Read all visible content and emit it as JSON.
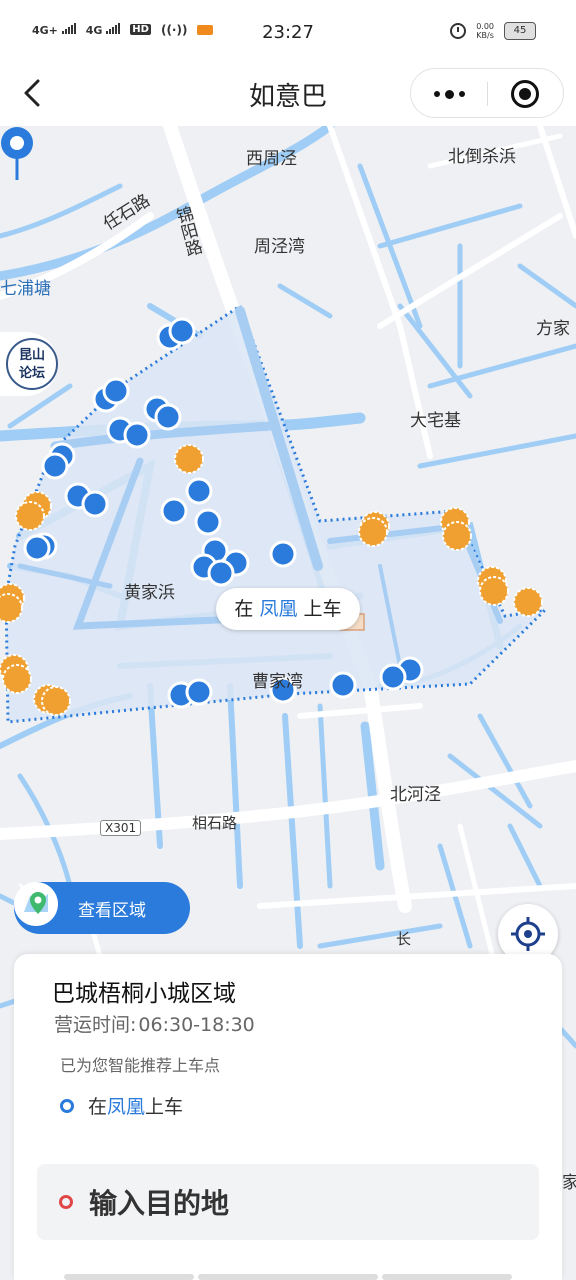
{
  "status_bar": {
    "network_1": "4G+",
    "network_2": "4G",
    "hd": "HD",
    "time": "23:27",
    "speed_value": "0.00",
    "speed_unit": "KB/s",
    "battery": "45"
  },
  "nav": {
    "title": "如意巴",
    "back_icon": "chevron-left-icon",
    "more_icon": "more-dots-icon",
    "close_icon": "target-close-icon"
  },
  "map": {
    "places": {
      "xizhoujing": "西周泾",
      "beidaoshabang": "北倒杀浜",
      "renshilu": "任石路",
      "jinyanglu": "锦阳路",
      "zhoujingwan": "周泾湾",
      "qiputang": "七浦塘",
      "fangjia": "方家",
      "dazhaiji": "大宅基",
      "huangjiabang": "黄家浜",
      "caojiawan": "曹家湾",
      "beihejing": "北河泾",
      "xiangshilu": "相石路",
      "x301": "X301",
      "chang": "长",
      "jia": "家"
    },
    "forum_logo": "昆山论坛",
    "pickup_bubble": {
      "prefix": "在",
      "station": "凤凰",
      "suffix": "上车"
    },
    "view_area_button": "查看区域",
    "locate_icon": "crosshair-locate-icon",
    "colors": {
      "zone_fill": "#dbe5f5",
      "zone_border": "#2a7bdc",
      "stop_blue": "#2a7bdc",
      "stop_orange": "#f0a030",
      "water": "#9fcdf5"
    }
  },
  "card": {
    "zone_name": "巴城梧桐小城区域",
    "hours_label": "营运时间:",
    "hours_value": "06:30-18:30",
    "recommend_text": "已为您智能推荐上车点",
    "pickup_prefix": "在",
    "pickup_station": "凤凰",
    "pickup_suffix": "上车",
    "destination_placeholder": "输入目的地"
  }
}
